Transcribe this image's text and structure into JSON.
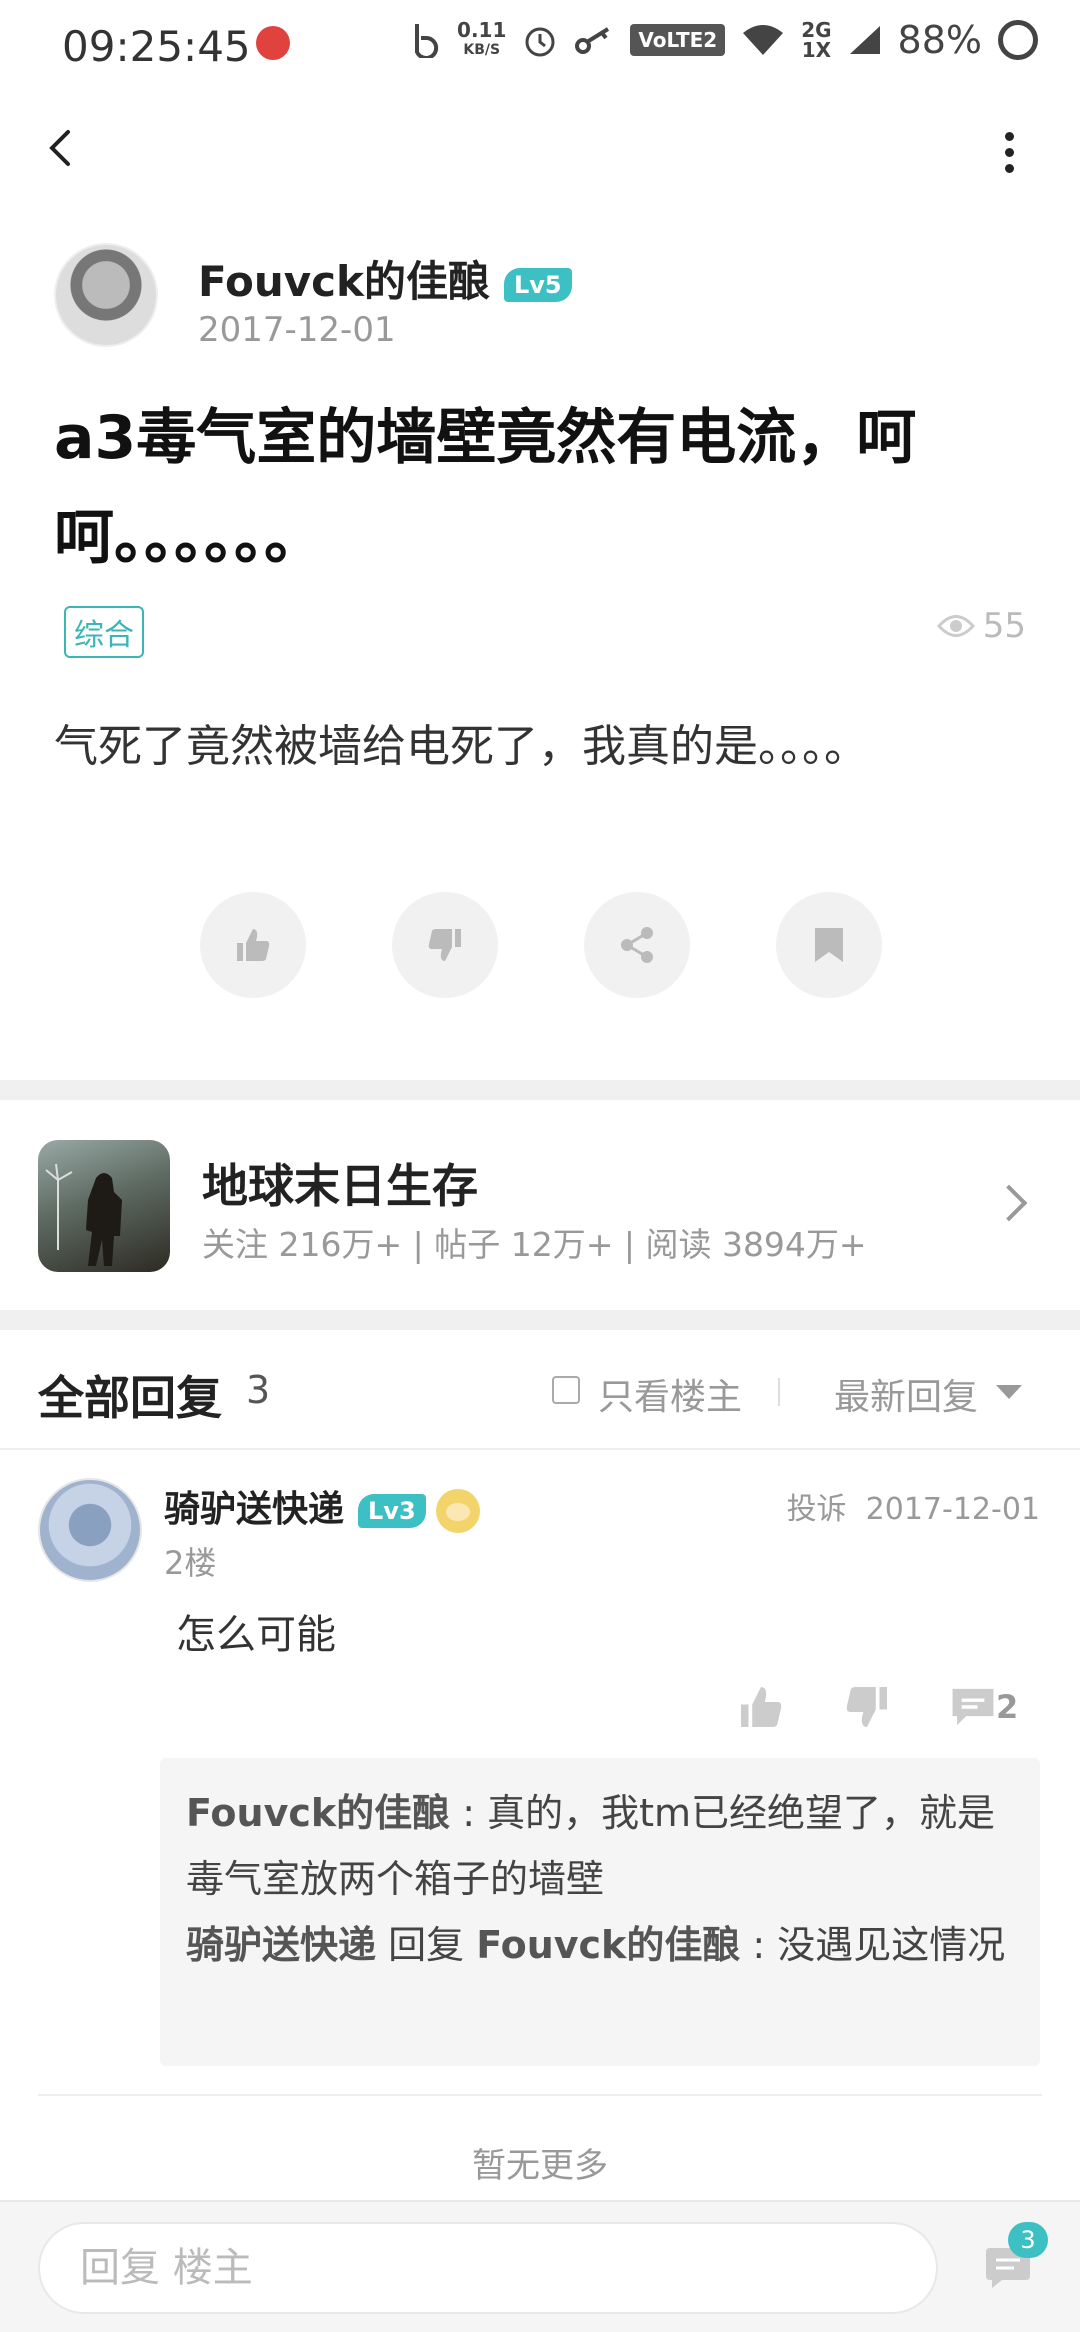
{
  "status_bar": {
    "time": "09:25:45",
    "net_speed_value": "0.11",
    "net_speed_unit": "KB/S",
    "volte": "VoLTE2",
    "net_2g": "2G",
    "net_1x": "1X",
    "battery": "88%"
  },
  "post": {
    "author": "Fouvck的佳酿",
    "author_level": "Lv5",
    "date": "2017-12-01",
    "title": "a3毒气室的墙壁竟然有电流，呵呵。。。。。。",
    "tag": "综合",
    "views": "55",
    "body": "气死了竟然被墙给电死了，我真的是。。。。"
  },
  "game": {
    "name": "地球末日生存",
    "stats": "关注 216万+ | 帖子 12万+ | 阅读 3894万+"
  },
  "replies_header": {
    "title": "全部回复",
    "count": "3",
    "only_op": "只看楼主",
    "sort": "最新回复"
  },
  "reply": {
    "user": "骑驴送快递",
    "level": "Lv3",
    "report": "投诉",
    "date": "2017-12-01",
    "floor": "2楼",
    "text": "怎么可能",
    "comment_count": "2",
    "sub1_user": "Fouvck的佳酿",
    "sub1_text": " : 真的，我tm已经绝望了，就是毒气室放两个箱子的墙壁",
    "sub2_user": "骑驴送快递",
    "sub2_mid": " 回复 ",
    "sub2_target": "Fouvck的佳酿",
    "sub2_text": " : 没遇见这情况"
  },
  "footer": {
    "no_more": "暂无更多",
    "reply_placeholder": "回复  楼主",
    "message_badge": "3"
  },
  "colors": {
    "accent": "#3cc0c4",
    "separator": "#f0f0f0"
  }
}
